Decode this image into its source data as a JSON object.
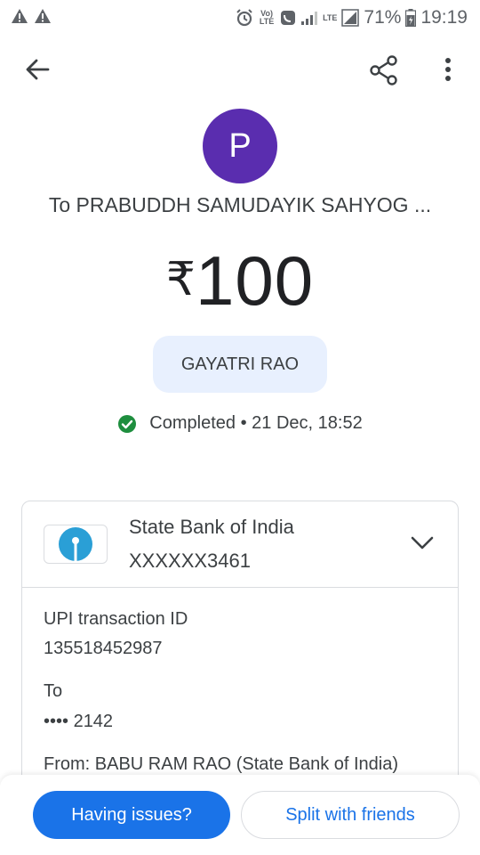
{
  "status_bar": {
    "battery": "71%",
    "time": "19:19",
    "volte_top": "Vo)",
    "volte_bottom": "LTE",
    "lte_label": "LTE",
    "icons": [
      "warning-icon",
      "warning-icon",
      "alarm-icon",
      "volte-icon",
      "data-saver-icon",
      "signal-icon",
      "lte-signal-icon",
      "battery-charging-icon"
    ]
  },
  "app_bar": {
    "icons": [
      "back-arrow-icon",
      "share-icon",
      "more-vert-icon"
    ]
  },
  "payment": {
    "avatar_letter": "P",
    "avatar_color": "#5a2daf",
    "payee": "To PRABUDDH SAMUDAYIK SAHYOG ...",
    "currency": "₹",
    "amount": "100",
    "note": "GAYATRI RAO",
    "status": "Completed",
    "separator": "•",
    "date": "21 Dec, 18:52",
    "status_color": "#1e8e3e"
  },
  "account": {
    "bank_name": "State Bank of India",
    "account_masked": "XXXXXX3461",
    "logo_color": "#2a9fd6"
  },
  "details": {
    "txn_label": "UPI transaction ID",
    "txn_id": "135518452987",
    "to_label": "To",
    "to_value": "•••• 2142",
    "from_line": "From: BABU RAM  RAO (State Bank of India)"
  },
  "actions": {
    "issues_label": "Having issues?",
    "split_label": "Split with friends",
    "accent": "#1a73e8"
  }
}
